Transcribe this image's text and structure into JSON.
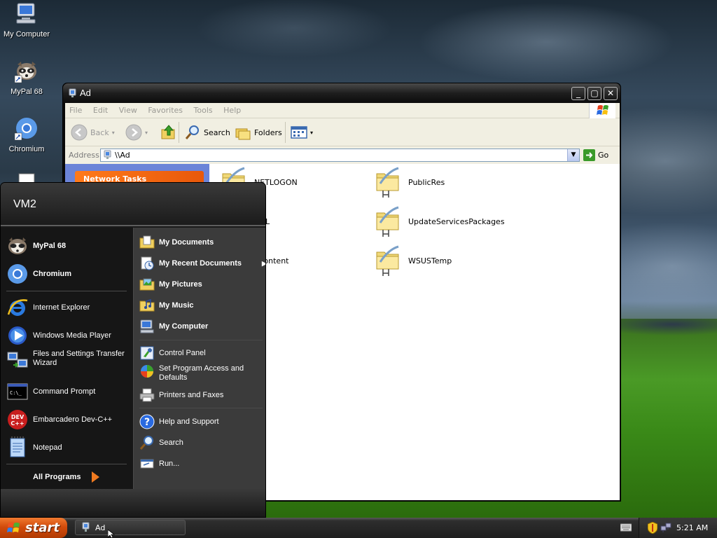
{
  "desktop": {
    "icons": [
      {
        "label": "My Computer"
      },
      {
        "label": "MyPal 68"
      },
      {
        "label": "Chromium"
      }
    ]
  },
  "explorer": {
    "title": "Ad",
    "menu": [
      "File",
      "Edit",
      "View",
      "Favorites",
      "Tools",
      "Help"
    ],
    "toolbar": {
      "back": "Back",
      "search": "Search",
      "folders": "Folders"
    },
    "address": {
      "label": "Address",
      "value": "\\\\Ad",
      "go": "Go"
    },
    "tasks_header": "Network Tasks",
    "shares": [
      {
        "name": "NETLOGON"
      },
      {
        "name": "PublicRes"
      },
      {
        "name": "SYSVOL"
      },
      {
        "name": "UpdateServicesPackages"
      },
      {
        "name": "WsusContent"
      },
      {
        "name": "WSUSTemp"
      }
    ],
    "visible_share_labels": [
      "NETLOGON",
      "PublicRes",
      "VOL",
      "UpdateServicesPackages",
      "sContent",
      "WSUSTemp"
    ]
  },
  "start_menu": {
    "user": "VM2",
    "pinned": [
      "MyPal 68",
      "Chromium"
    ],
    "recent": [
      "Internet Explorer",
      "Windows Media Player",
      "Files and Settings Transfer Wizard",
      "Command Prompt",
      "Embarcadero Dev-C++",
      "Notepad"
    ],
    "all_programs": "All Programs",
    "right": {
      "my_documents": "My Documents",
      "my_recent_documents": "My Recent Documents",
      "my_pictures": "My Pictures",
      "my_music": "My Music",
      "my_computer": "My Computer",
      "control_panel": "Control Panel",
      "set_program_access": "Set Program Access and Defaults",
      "printers": "Printers and Faxes",
      "help": "Help and Support",
      "search": "Search",
      "run": "Run..."
    }
  },
  "taskbar": {
    "start": "start",
    "task": "Ad",
    "clock": "5:21 AM"
  },
  "colors": {
    "start_orange": "#d24c0c",
    "tasks_orange": "#ff7a1a",
    "tasks_pane_blue": "#6b84d8",
    "go_green": "#3a9a2a"
  }
}
